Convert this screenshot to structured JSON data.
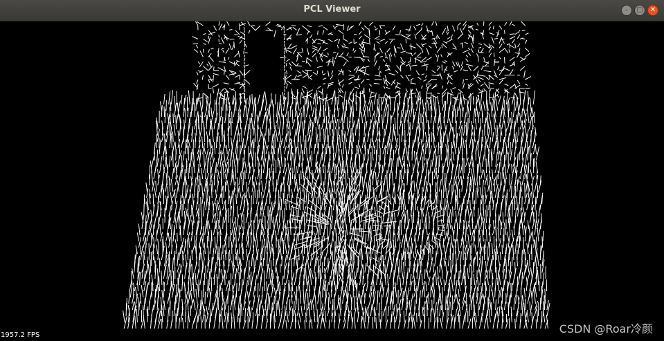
{
  "window": {
    "title": "PCL Viewer",
    "controls": {
      "minimize_icon": "minimize-icon",
      "maximize_icon": "maximize-icon",
      "close_icon": "close-icon"
    },
    "accent_close": "#e95420",
    "titlebar_color": "#3c3b37"
  },
  "viewer": {
    "background": "#000000",
    "stroke_color": "#ffffff",
    "fps_text": "1957.2 FPS",
    "watermark": "CSDN @Roar冷颜"
  }
}
